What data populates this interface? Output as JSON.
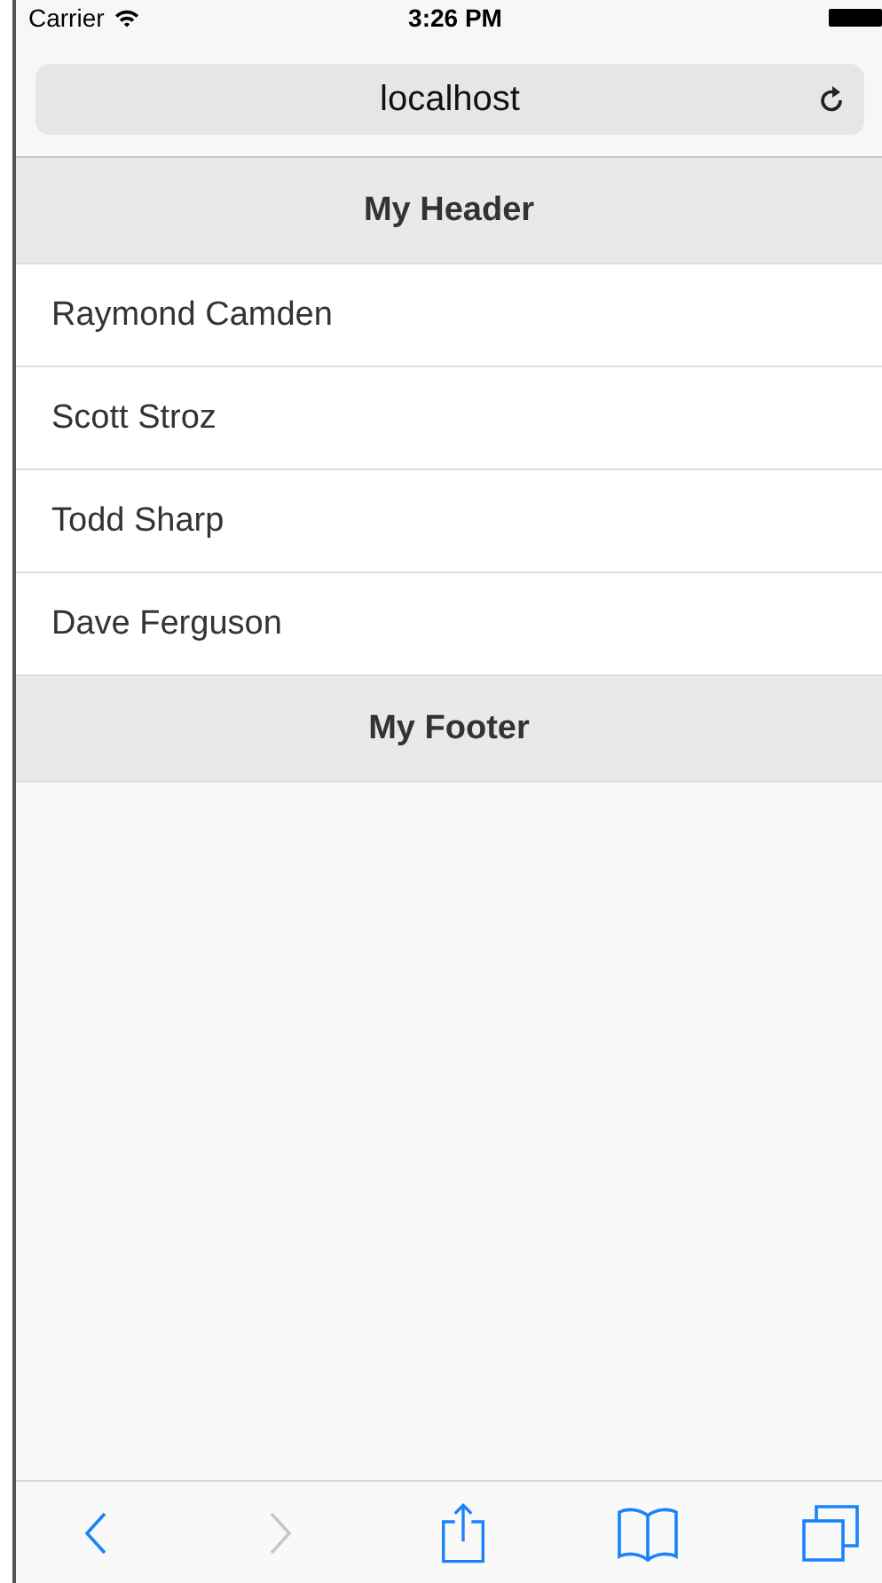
{
  "status_bar": {
    "carrier": "Carrier",
    "time": "3:26 PM"
  },
  "address_bar": {
    "url": "localhost"
  },
  "header": {
    "title": "My Header"
  },
  "list": {
    "items": [
      "Raymond Camden",
      "Scott Stroz",
      "Todd Sharp",
      "Dave Ferguson"
    ]
  },
  "footer": {
    "title": "My Footer"
  },
  "toolbar": [
    {
      "kind": "back",
      "disabled": false
    },
    {
      "kind": "forward",
      "disabled": true
    },
    {
      "kind": "share",
      "disabled": false
    },
    {
      "kind": "bookmarks",
      "disabled": false
    },
    {
      "kind": "tabs",
      "disabled": false
    }
  ]
}
